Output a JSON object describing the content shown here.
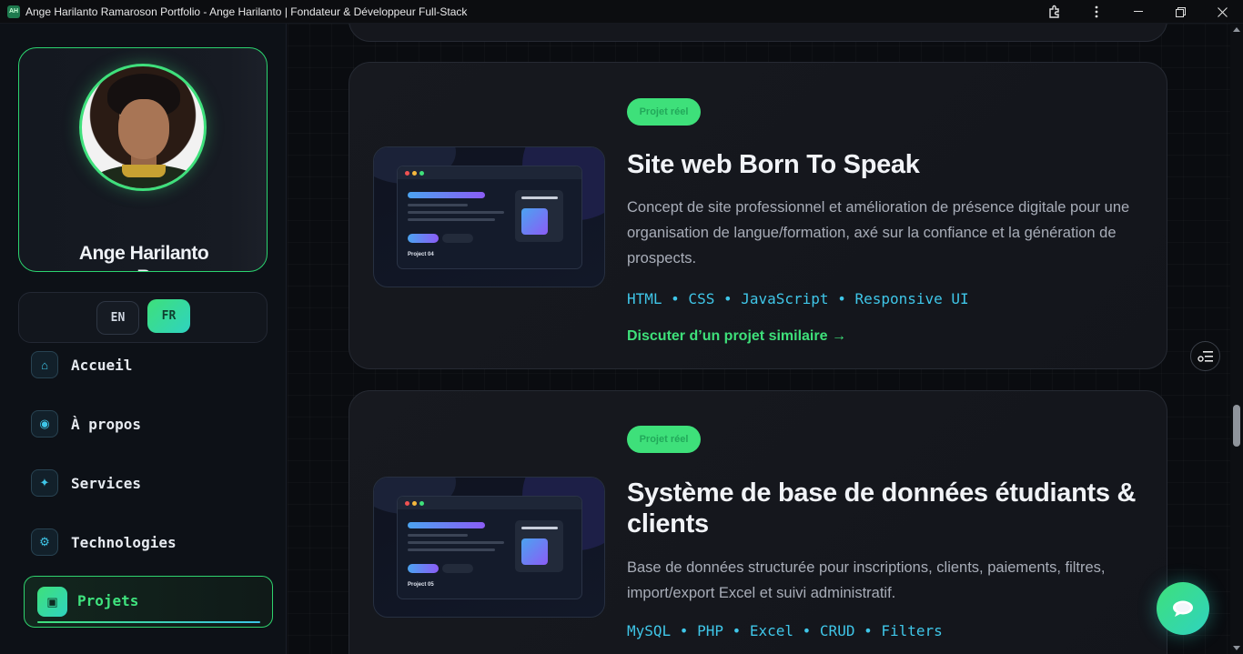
{
  "window": {
    "app_icon_text": "AH",
    "title": "Ange Harilanto Ramaroson Portfolio - Ange Harilanto | Fondateur & Développeur Full-Stack"
  },
  "sidebar": {
    "profile_name_line1": "Ange Harilanto",
    "profile_name_line2": "R",
    "languages": {
      "en": "EN",
      "fr": "FR",
      "active": "FR"
    },
    "nav": [
      {
        "label": "Accueil",
        "icon": "home-icon",
        "glyph": "⌂"
      },
      {
        "label": "À propos",
        "icon": "user-circle-icon",
        "glyph": "◉"
      },
      {
        "label": "Services",
        "icon": "sparkle-icon",
        "glyph": "✦"
      },
      {
        "label": "Technologies",
        "icon": "gear-icon",
        "glyph": "⚙"
      },
      {
        "label": "Projets",
        "icon": "project-icon",
        "glyph": "▣",
        "active": true
      }
    ]
  },
  "projects": [
    {
      "badge": "Projet réel",
      "thumb_caption": "Project 04",
      "title": "Site web Born To Speak",
      "description": "Concept de site professionnel et amélioration de présence digitale pour une organisation de langue/formation, axé sur la confiance et la génération de prospects.",
      "tech": "HTML • CSS • JavaScript • Responsive UI",
      "cta": "Discuter d’un projet similaire →"
    },
    {
      "badge": "Projet réel",
      "thumb_caption": "Project 05",
      "title": "Système de base de données étudiants & clients",
      "description": "Base de données structurée pour inscriptions, clients, paiements, filtres, import/export Excel et suivi administratif.",
      "tech": "MySQL • PHP • Excel • CRUD • Filters"
    }
  ],
  "colors": {
    "accent_green": "#3ee07a",
    "accent_cyan": "#3fc6e8",
    "background": "#0a0c10"
  }
}
